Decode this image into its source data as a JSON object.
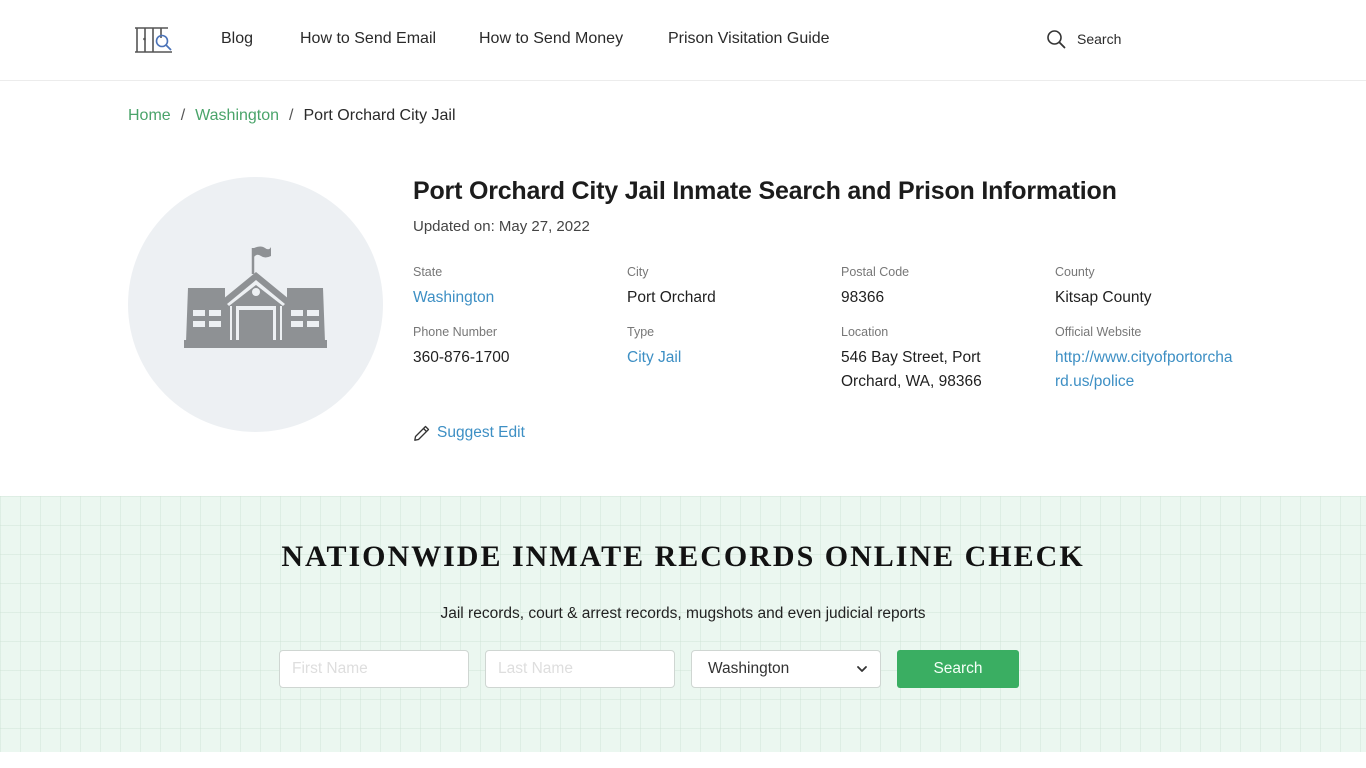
{
  "header": {
    "logo_icon": "prison-bars-search-icon",
    "nav": [
      {
        "label": "Blog"
      },
      {
        "label": "How to Send Email"
      },
      {
        "label": "How to Send Money"
      },
      {
        "label": "Prison Visitation Guide"
      }
    ],
    "search_label": "Search"
  },
  "breadcrumb": {
    "items": [
      {
        "label": "Home"
      },
      {
        "label": "Washington"
      }
    ],
    "separator": "/",
    "current": "Port Orchard City Jail"
  },
  "facility": {
    "image_icon": "building-with-flag-icon",
    "title": "Port Orchard City Jail Inmate Search and Prison Information",
    "updated": "Updated on: May 27, 2022",
    "fields": {
      "state": {
        "label": "State",
        "value": "Washington"
      },
      "city": {
        "label": "City",
        "value": "Port Orchard"
      },
      "postal": {
        "label": "Postal Code",
        "value": "98366"
      },
      "county": {
        "label": "County",
        "value": "Kitsap County"
      },
      "phone": {
        "label": "Phone Number",
        "value": "360-876-1700"
      },
      "type": {
        "label": "Type",
        "value": "City Jail"
      },
      "location": {
        "label": "Location",
        "value": "546 Bay Street, Port Orchard, WA, 98366"
      },
      "website": {
        "label": "Official Website",
        "value": "http://www.cityofportorchard.us/police"
      }
    },
    "suggest_edit": "Suggest Edit"
  },
  "records": {
    "title": "NATIONWIDE INMATE RECORDS ONLINE CHECK",
    "subtitle": "Jail records, court & arrest records, mugshots and even judicial reports",
    "first_name_placeholder": "First Name",
    "last_name_placeholder": "Last Name",
    "state_selected": "Washington",
    "submit_label": "Search"
  },
  "colors": {
    "accent_green": "#3aae62",
    "breadcrumb_link": "#4aa46a",
    "link_blue": "#3d8fc4",
    "section_bg": "#ebf7f0"
  }
}
